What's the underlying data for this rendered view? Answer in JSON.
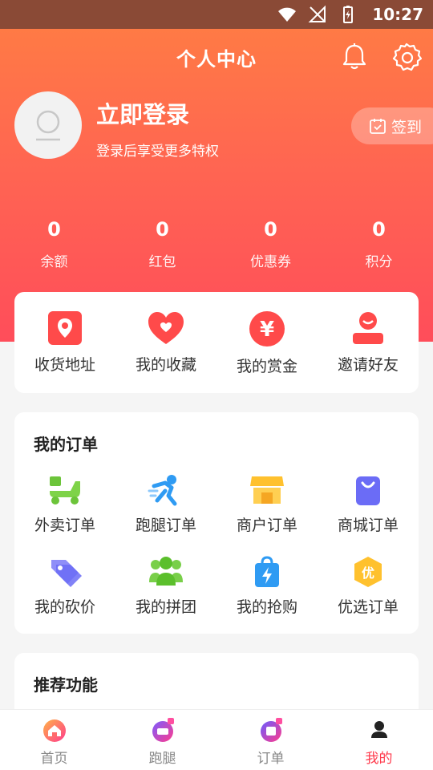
{
  "status_bar": {
    "time": "10:27"
  },
  "header": {
    "title": "个人中心",
    "login_title": "立即登录",
    "login_subtitle": "登录后享受更多特权",
    "signin_label": "签到"
  },
  "stats": [
    {
      "value": "0",
      "label": "余额"
    },
    {
      "value": "0",
      "label": "红包"
    },
    {
      "value": "0",
      "label": "优惠券"
    },
    {
      "value": "0",
      "label": "积分"
    }
  ],
  "quick_actions": [
    {
      "label": "收货地址",
      "icon": "location-icon"
    },
    {
      "label": "我的收藏",
      "icon": "heart-icon"
    },
    {
      "label": "我的赏金",
      "icon": "yuan-icon"
    },
    {
      "label": "邀请好友",
      "icon": "invite-user-icon"
    }
  ],
  "orders": {
    "title": "我的订单",
    "items": [
      {
        "label": "外卖订单",
        "icon": "delivery-scooter-icon"
      },
      {
        "label": "跑腿订单",
        "icon": "runner-icon"
      },
      {
        "label": "商户订单",
        "icon": "shop-icon"
      },
      {
        "label": "商城订单",
        "icon": "shopping-bag-icon"
      },
      {
        "label": "我的砍价",
        "icon": "price-tag-icon"
      },
      {
        "label": "我的拼团",
        "icon": "group-icon"
      },
      {
        "label": "我的抢购",
        "icon": "flash-bag-icon"
      },
      {
        "label": "优选订单",
        "icon": "select-badge-icon"
      }
    ]
  },
  "recommend": {
    "title": "推荐功能"
  },
  "bottom_nav": [
    {
      "label": "首页",
      "icon": "home-icon"
    },
    {
      "label": "跑腿",
      "icon": "errand-icon"
    },
    {
      "label": "订单",
      "icon": "order-icon"
    },
    {
      "label": "我的",
      "icon": "profile-icon"
    }
  ],
  "colors": {
    "accent": "#ff3b4d",
    "header_top": "#ff7a45",
    "header_bottom": "#ff4d5a"
  }
}
